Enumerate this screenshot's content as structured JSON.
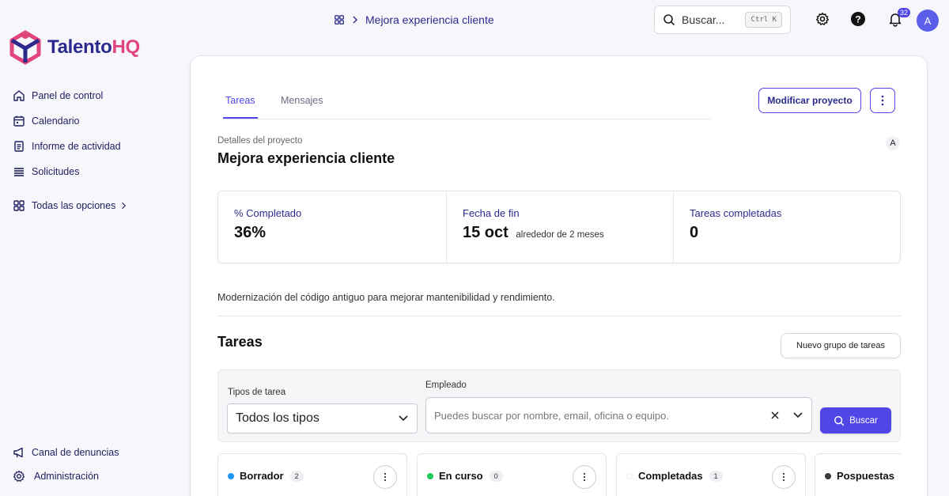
{
  "brand": {
    "name_part1": "Talento",
    "name_part2": "HQ",
    "color_primary": "#2b2a8c",
    "color_accent": "#e0457b"
  },
  "sidebar": {
    "items": [
      {
        "label": "Panel de control",
        "icon": "home-icon"
      },
      {
        "label": "Calendario",
        "icon": "calendar-icon"
      },
      {
        "label": "Informe de actividad",
        "icon": "report-icon"
      },
      {
        "label": "Solicitudes",
        "icon": "list-icon"
      },
      {
        "label": "Todas las opciones",
        "icon": "grid-icon"
      }
    ],
    "bottom": [
      {
        "label": "Canal de denuncias",
        "icon": "megaphone-icon"
      },
      {
        "label": "Administración",
        "icon": "gear-icon"
      }
    ]
  },
  "topbar": {
    "breadcrumb": "Mejora experiencia cliente",
    "search_placeholder": "Buscar...",
    "search_shortcut": "Ctrl K",
    "notifications_count": "32",
    "avatar_initial": "A"
  },
  "project": {
    "tabs": [
      "Tareas",
      "Mensajes"
    ],
    "edit_button": "Modificar proyecto",
    "subtitle": "Detalles del proyecto",
    "title": "Mejora experiencia cliente",
    "owner_initial": "A",
    "stats": [
      {
        "label": "% Completado",
        "value": "36%",
        "sub": ""
      },
      {
        "label": "Fecha de fin",
        "value": "15 oct",
        "sub": "alrededor de 2 meses"
      },
      {
        "label": "Tareas completadas",
        "value": "0",
        "sub": ""
      }
    ],
    "description": "Modernización del código antiguo para mejorar mantenibilidad y rendimiento."
  },
  "tasks": {
    "title": "Tareas",
    "new_group_button": "Nuevo grupo de tareas",
    "filters": {
      "type_label": "Tipos de tarea",
      "type_value": "Todos los tipos",
      "employee_label": "Empleado",
      "employee_placeholder": "Puedes buscar por nombre, email, oficina o equipo.",
      "search_button": "Buscar"
    },
    "columns": [
      {
        "name": "Borrador",
        "count": "2",
        "color": "#2196f3"
      },
      {
        "name": "En curso",
        "count": "0",
        "color": "#22c55e"
      },
      {
        "name": "Completadas",
        "count": "1",
        "color": "#ffffff"
      },
      {
        "name": "Pospuestas",
        "count": "",
        "color": "#3a3a3a"
      }
    ]
  }
}
